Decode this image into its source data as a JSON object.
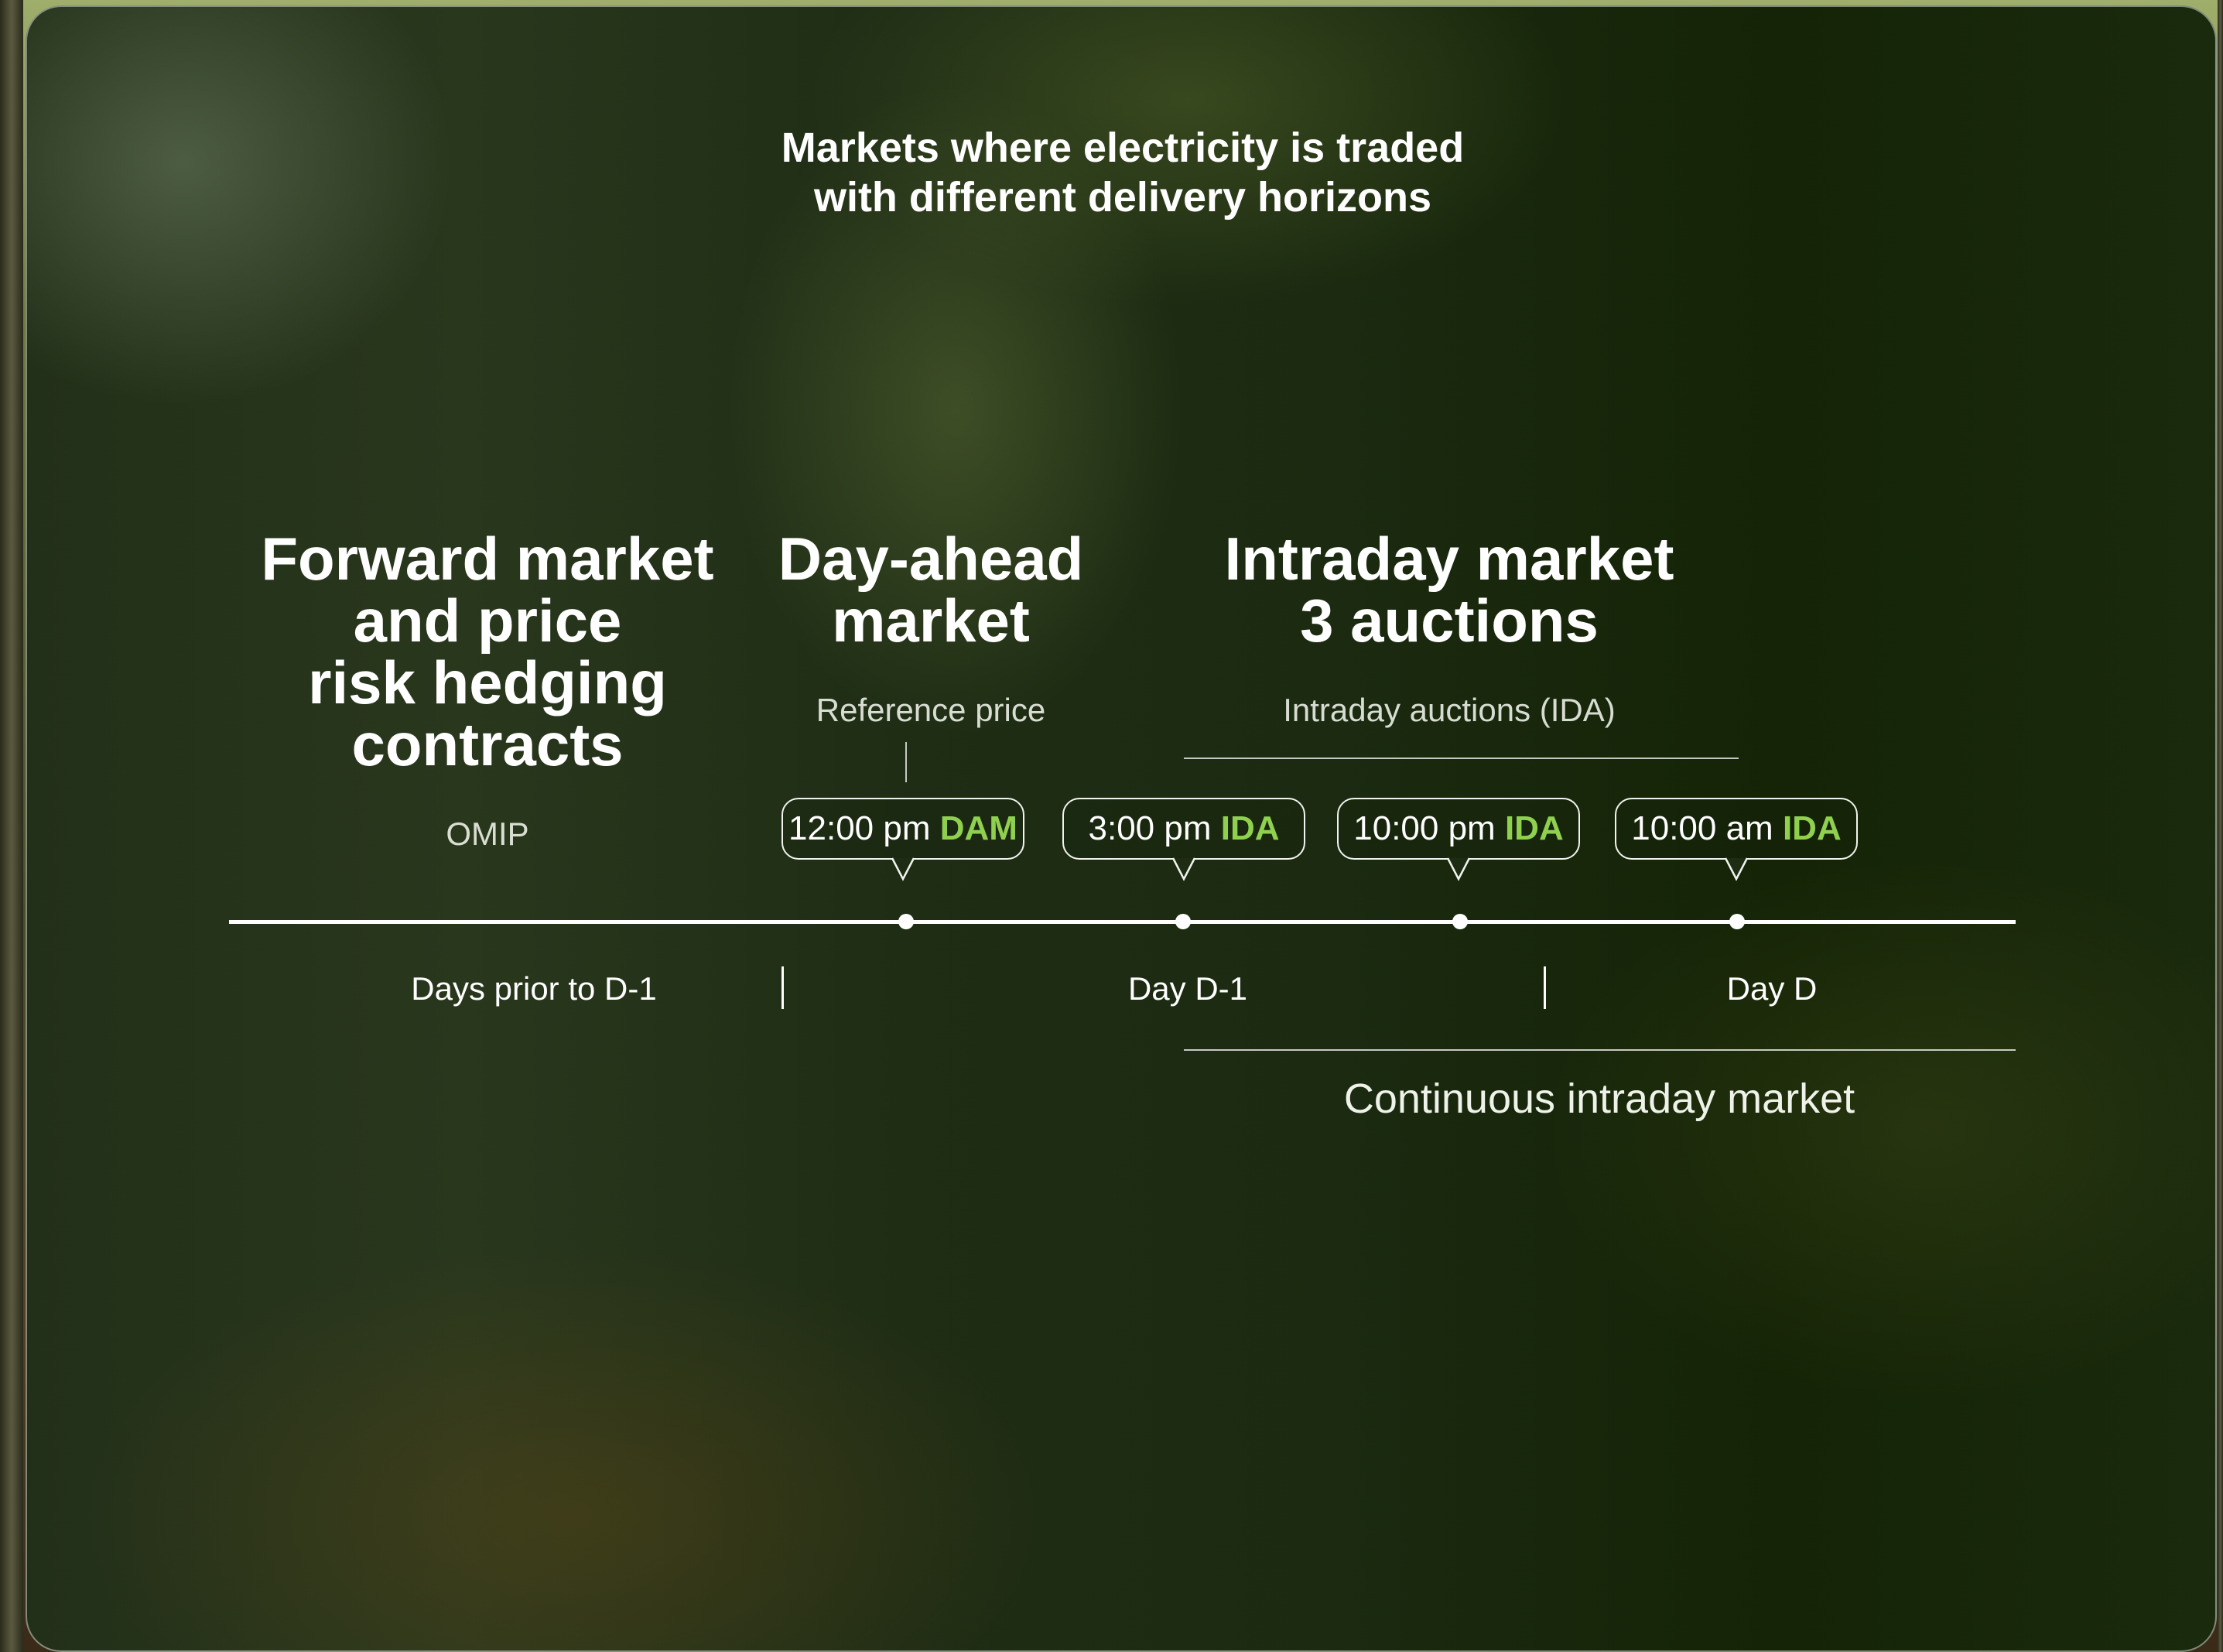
{
  "title_line1": "Markets where electricity is traded",
  "title_line2": "with different delivery horizons",
  "forward": {
    "lines": [
      "Forward market",
      "and price",
      "risk hedging",
      "contracts"
    ],
    "sub": "OMIP"
  },
  "day_ahead": {
    "lines": [
      "Day-ahead",
      "market"
    ],
    "sub": "Reference price"
  },
  "intraday": {
    "lines": [
      "Intraday market",
      "3 auctions"
    ],
    "sub": "Intraday auctions (IDA)"
  },
  "badges": [
    {
      "time": "12:00 pm",
      "code": "DAM"
    },
    {
      "time": "3:00 pm",
      "code": "IDA"
    },
    {
      "time": "10:00 pm",
      "code": "IDA"
    },
    {
      "time": "10:00 am",
      "code": "IDA"
    }
  ],
  "periods": [
    "Days prior to D-1",
    "Day D-1",
    "Day D"
  ],
  "continuous": "Continuous intraday market",
  "colors": {
    "accent_green": "#8fd14f",
    "line_white": "#ffffff",
    "card_bg": "#1f2d15"
  }
}
